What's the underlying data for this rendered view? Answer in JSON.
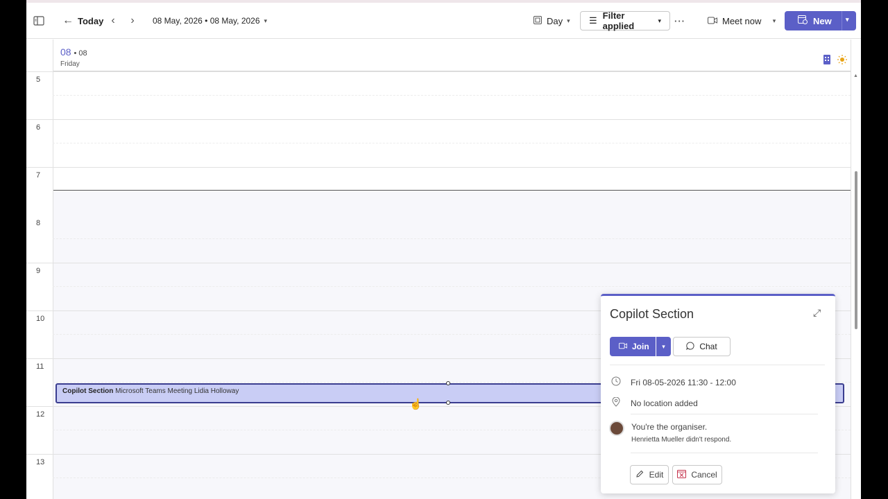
{
  "toolbar": {
    "today_label": "Today",
    "date_range": "08 May, 2026 • 08 May, 2026",
    "view_label": "Day",
    "filter_label": "Filter applied",
    "more_label": "···",
    "meet_now_label": "Meet now",
    "new_label": "New"
  },
  "day_header": {
    "day_number": "08",
    "day_small": "• 08",
    "day_name": "Friday"
  },
  "hours": [
    "5",
    "6",
    "7",
    "8",
    "9",
    "10",
    "11",
    "12",
    "13"
  ],
  "event": {
    "title": "Copilot Section",
    "details": " Microsoft Teams Meeting Lidia Holloway"
  },
  "popup": {
    "title": "Copilot Section",
    "join_label": "Join",
    "chat_label": "Chat",
    "datetime": "Fri 08-05-2026 11:30 - 12:00",
    "location": "No location added",
    "organiser": "You're the organiser.",
    "response": "Henrietta Mueller didn't respond.",
    "edit_label": "Edit",
    "cancel_label": "Cancel"
  },
  "colors": {
    "accent": "#5b5fc7",
    "event_fill": "#c9cdf5",
    "event_border": "#3a3d8f"
  }
}
